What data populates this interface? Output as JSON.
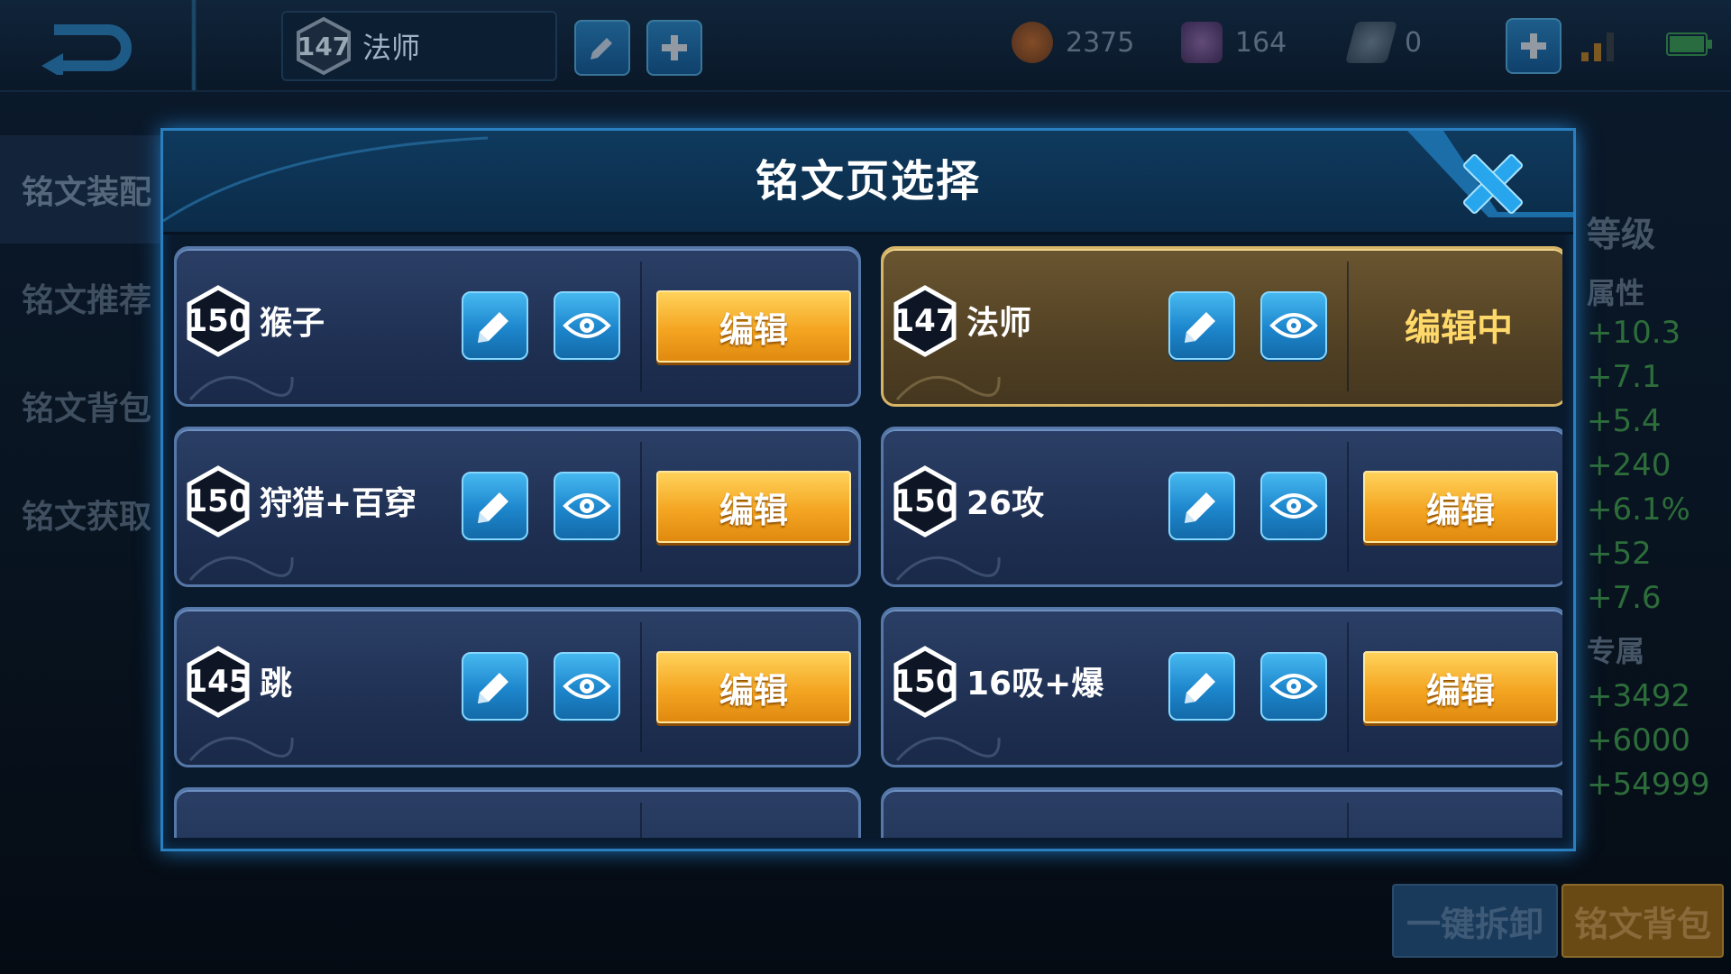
{
  "topbar": {
    "current_page_level": "147",
    "current_page_name": "法师",
    "gold": "2375",
    "diamond": "164",
    "coupon": "0"
  },
  "side_nav": [
    "铭文装配",
    "铭文推荐",
    "铭文背包",
    "铭文获取"
  ],
  "right_panel": {
    "level_label": "等级",
    "attr_label": "属性",
    "attr_values": [
      "+10.3",
      "+7.1",
      "+5.4",
      "+240",
      "+6.1%",
      "+52",
      "+7.6"
    ],
    "exclusive_label": "专属",
    "exclusive_values": [
      "+3492",
      "+6000",
      "+54999"
    ]
  },
  "bottom_buttons": {
    "unload_all": "一键拆卸",
    "rune_bag": "铭文背包"
  },
  "dialog": {
    "title": "铭文页选择",
    "edit_label": "编辑",
    "editing_label": "编辑中",
    "pages": [
      {
        "level": "150",
        "name": "猴子",
        "current": false
      },
      {
        "level": "147",
        "name": "法师",
        "current": true
      },
      {
        "level": "150",
        "name": "狩猎+百穿",
        "current": false
      },
      {
        "level": "150",
        "name": "26攻",
        "current": false
      },
      {
        "level": "145",
        "name": "跳",
        "current": false
      },
      {
        "level": "150",
        "name": "16吸+爆",
        "current": false
      }
    ]
  },
  "colors": {
    "accent_blue": "#2a7fc0",
    "gold_button": "#f4a521",
    "current_card": "#6a5530",
    "stat_green": "#2d6d3a"
  }
}
